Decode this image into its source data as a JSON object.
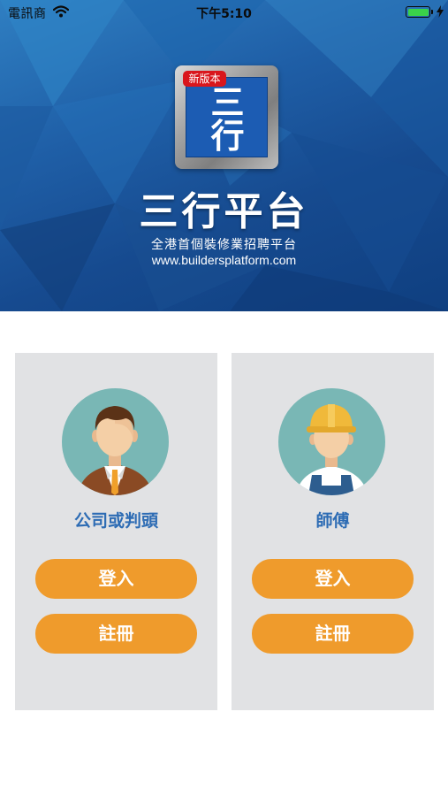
{
  "status_bar": {
    "carrier": "電訊商",
    "time": "下午5:10"
  },
  "header": {
    "logo_badge": "新版本",
    "logo_chars": [
      "三",
      "行"
    ],
    "title": "三行平台",
    "subtitle": "全港首個裝修業招聘平台",
    "url": "www.buildersplatform.com"
  },
  "cards": [
    {
      "role": "公司或判頭",
      "login_label": "登入",
      "register_label": "註冊",
      "avatar_icon": "businessman-avatar-icon"
    },
    {
      "role": "師傅",
      "login_label": "登入",
      "register_label": "註冊",
      "avatar_icon": "worker-avatar-icon"
    }
  ],
  "colors": {
    "header_blue": "#1f5fa7",
    "card_bg": "#e1e2e4",
    "role_text": "#2d6cb4",
    "button_orange": "#ef9b2c",
    "badge_red": "#d9161c"
  }
}
